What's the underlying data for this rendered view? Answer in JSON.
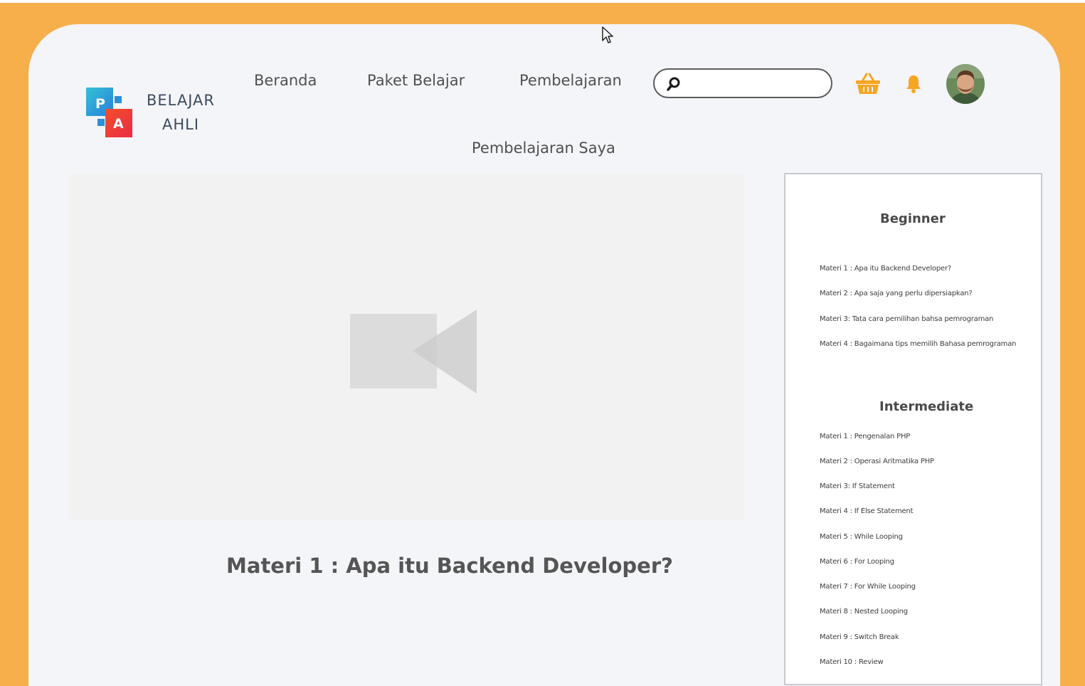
{
  "brand": {
    "line1": "BELAJAR",
    "line2": "AHLI",
    "logo_letters": [
      "P",
      "A"
    ]
  },
  "nav": {
    "items": [
      "Beranda",
      "Paket Belajar",
      "Pembelajaran"
    ],
    "sub_item": "Pembelajaran Saya"
  },
  "search": {
    "value": "",
    "icon": "search-icon"
  },
  "icons": {
    "cart": "basket-icon",
    "notification": "bell-icon",
    "accent": "#f6af4b"
  },
  "video": {
    "icon": "video-camera-icon"
  },
  "lesson": {
    "title": "Materi 1 : Apa itu Backend Developer?"
  },
  "curriculum": {
    "beginner": {
      "title": "Beginner",
      "items": [
        "Materi 1 : Apa itu Backend Developer?",
        "Materi 2 : Apa saja yang perlu dipersiapkan?",
        "Materi 3: Tata cara pemilihan bahsa pemrograman",
        "Materi 4 : Bagaimana tips memilih Bahasa pemrograman"
      ]
    },
    "intermediate": {
      "title": "Intermediate",
      "items": [
        "Materi 1 : Pengenalan PHP",
        "Materi 2 : Operasi Aritmatika PHP",
        "Materi 3: If Statement",
        "Materi 4 : If Else Statement",
        "Materi 5 : While Looping",
        "Materi 6 : For Looping",
        "Materi 7 : For While Looping",
        "Materi 8 : Nested Looping",
        "Materi 9 : Switch Break",
        "Materi 10 : Review"
      ]
    }
  }
}
